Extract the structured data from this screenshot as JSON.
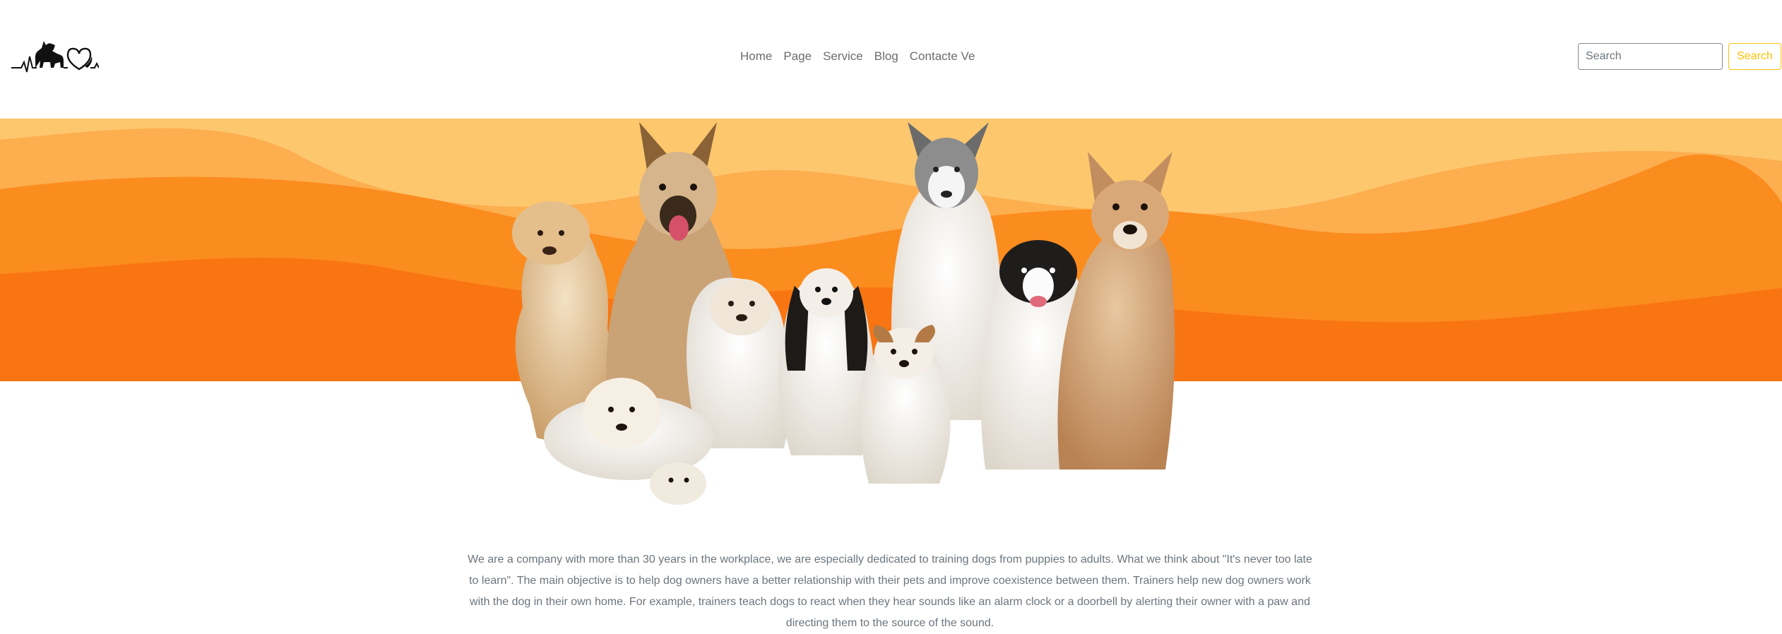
{
  "nav": {
    "logo_icon": "dog-heartbeat-logo-icon",
    "links": [
      {
        "label": "Home"
      },
      {
        "label": "Page"
      },
      {
        "label": "Service"
      },
      {
        "label": "Blog"
      },
      {
        "label": "Contacte Ve"
      }
    ],
    "search": {
      "placeholder": "Search",
      "button_label": "Search"
    }
  },
  "hero": {
    "image": "group-of-dogs-photo",
    "colors": {
      "light": "#FDC76E",
      "mid_light": "#FDAE4F",
      "mid": "#FB8C1E",
      "dark": "#F97511"
    }
  },
  "about": {
    "text": "We are a company with more than 30 years in the workplace, we are especially dedicated to training dogs from puppies to adults. What we think about \"It's never too late to learn\". The main objective is to help dog owners have a better relationship with their pets and improve coexistence between them. Trainers help new dog owners work with the dog in their own home. For example, trainers teach dogs to react when they hear sounds like an alarm clock or a doorbell by alerting their owner with a paw and directing them to the source of the sound."
  }
}
